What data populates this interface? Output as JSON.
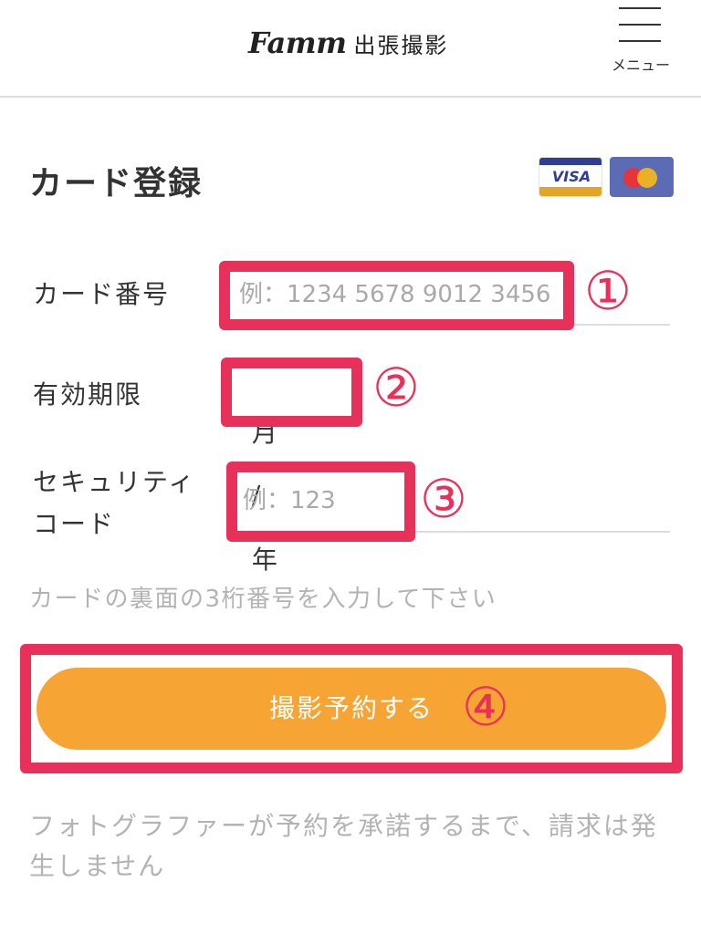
{
  "header": {
    "brand": "Famm",
    "service": "出張撮影",
    "menu_label": "メニュー"
  },
  "page": {
    "title": "カード登録"
  },
  "card_brands": {
    "visa_text": "VISA",
    "icons": [
      "visa-icon",
      "mastercard-icon"
    ],
    "visa_colors": {
      "navy": "#2f3f93",
      "gold": "#e5a524"
    },
    "mastercard_colors": {
      "bg": "#5b6bb4",
      "red": "#e5343d",
      "yellow": "#f5b81a"
    }
  },
  "form": {
    "card_number": {
      "label": "カード番号",
      "placeholder": "例：1234 5678 9012 3456",
      "value": ""
    },
    "expiry": {
      "label": "有効期限",
      "month": "月",
      "separator": "/",
      "year": "年"
    },
    "security_code": {
      "label_line1": "セキュリティ",
      "label_line2": "コード",
      "placeholder": "例：123",
      "value": ""
    },
    "hint": "カードの裏面の3桁番号を入力して下さい"
  },
  "submit": {
    "label": "撮影予約する"
  },
  "note": "フォトグラファーが予約を承諾するまで、請求は発生しません",
  "callouts": [
    "①",
    "②",
    "③",
    "④"
  ],
  "colors": {
    "accent_orange": "#f6a534",
    "callout_red": "#e8315a",
    "muted_text": "#b3b3b3"
  }
}
